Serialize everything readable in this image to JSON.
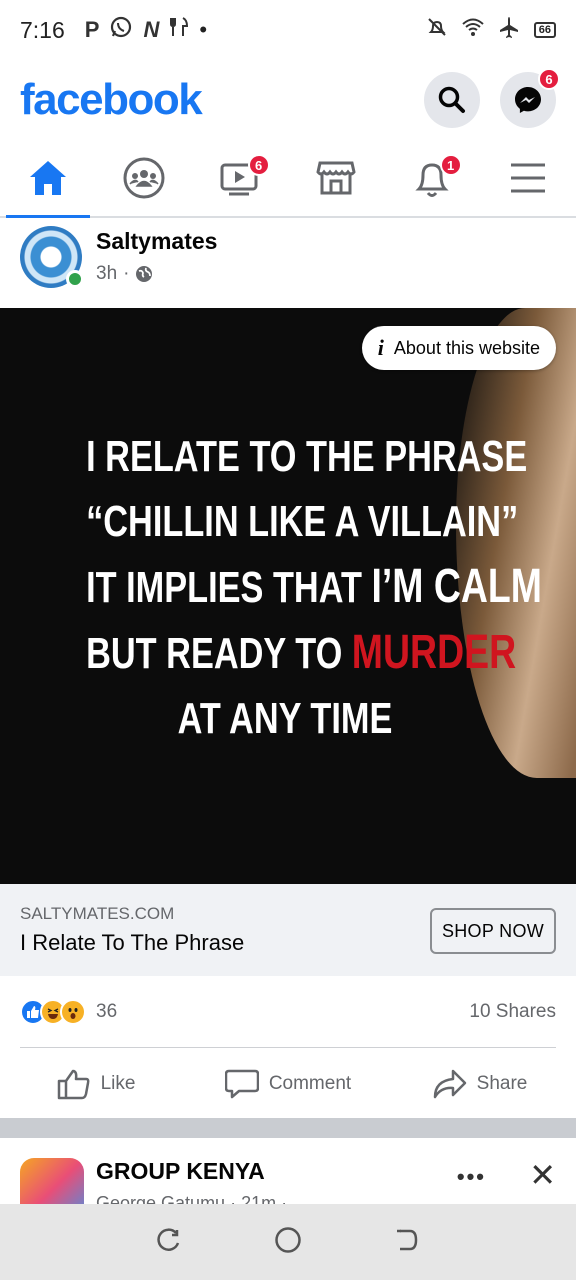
{
  "status_bar": {
    "time": "7:16",
    "left_icons": [
      "p-icon",
      "whatsapp-icon",
      "n-icon",
      "restaurant-icon"
    ],
    "battery": "66"
  },
  "header": {
    "logo": "facebook",
    "messenger_badge": "6"
  },
  "tabs": [
    {
      "name": "home",
      "badge": ""
    },
    {
      "name": "groups",
      "badge": ""
    },
    {
      "name": "watch",
      "badge": "6"
    },
    {
      "name": "marketplace",
      "badge": ""
    },
    {
      "name": "notifications",
      "badge": "1"
    },
    {
      "name": "menu",
      "badge": ""
    }
  ],
  "post": {
    "author": "Saltymates",
    "time": "3h",
    "dot": "·",
    "about_label": "About this website",
    "image_text": {
      "line1": "I RELATE TO THE PHRASE",
      "line2": "“CHILLIN LIKE A VILLAIN”",
      "line3a": "IT IMPLIES THAT ",
      "line3b": "I’M CALM",
      "line4a": "BUT READY TO ",
      "line4b": "MURDER",
      "line5": "AT ANY TIME"
    },
    "link_domain": "SALTYMATES.COM",
    "link_title": "I Relate To The Phrase",
    "cta": "SHOP NOW",
    "reaction_count": "36",
    "shares": "10 Shares",
    "actions": {
      "like": "Like",
      "comment": "Comment",
      "share": "Share"
    }
  },
  "next_post": {
    "group": "GROUP KENYA",
    "meta": "George Gatumu · 21m · "
  },
  "colors": {
    "brand": "#1877f2",
    "badge": "#e41e3f",
    "murder_red": "#d0151f"
  }
}
